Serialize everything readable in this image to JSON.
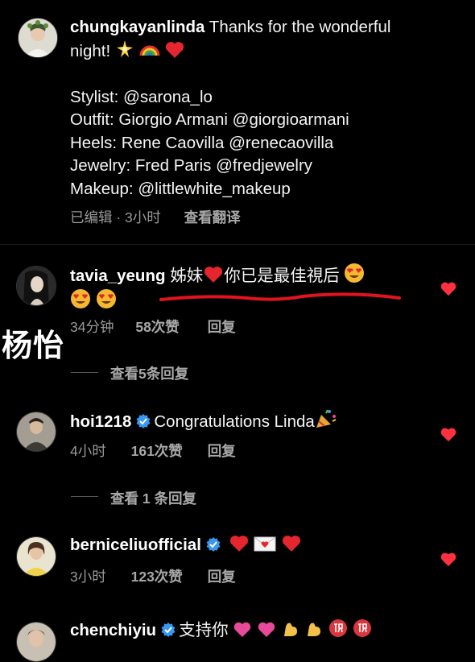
{
  "caption": {
    "username": "chungkayanlinda",
    "text_line1": "Thanks for the wonderful",
    "text_line2": "night!",
    "credits": [
      "Stylist: @sarona_lo",
      "Outfit: Giorgio Armani @giorgioarmani",
      "Heels: Rene Caovilla @renecaovilla",
      "Jewelry: Fred Paris @fredjewelry",
      "Makeup: @littlewhite_makeup"
    ],
    "edited": "已编辑 · 3小时",
    "translate": "查看翻译"
  },
  "comments": [
    {
      "username": "tavia_yeung",
      "text_a": "姊妹",
      "text_b": "你已是最佳視后",
      "time": "34分钟",
      "likes": "58次赞",
      "reply": "回复",
      "view_replies": "查看5条回复"
    },
    {
      "username": "hoi1218",
      "text": "Congratulations Linda",
      "time": "4小时",
      "likes": "161次赞",
      "reply": "回复",
      "view_replies": "查看 1 条回复"
    },
    {
      "username": "berniceliuofficial",
      "time": "3小时",
      "likes": "123次赞",
      "reply": "回复"
    },
    {
      "username": "chenchiyiu",
      "text": "支持你"
    }
  ],
  "watermark": "杨怡",
  "colors": {
    "background": "#000000",
    "heart": "#ff3040",
    "verified": "#3897f0",
    "annotation": "#e0141e"
  },
  "icons": [
    "heart-icon",
    "verified-badge-icon",
    "sparkle-icon",
    "rainbow-icon",
    "party-popper-icon",
    "heart-eyes-icon",
    "envelope-heart-icon",
    "flexed-biceps-icon",
    "congratulations-kanji-icon"
  ]
}
